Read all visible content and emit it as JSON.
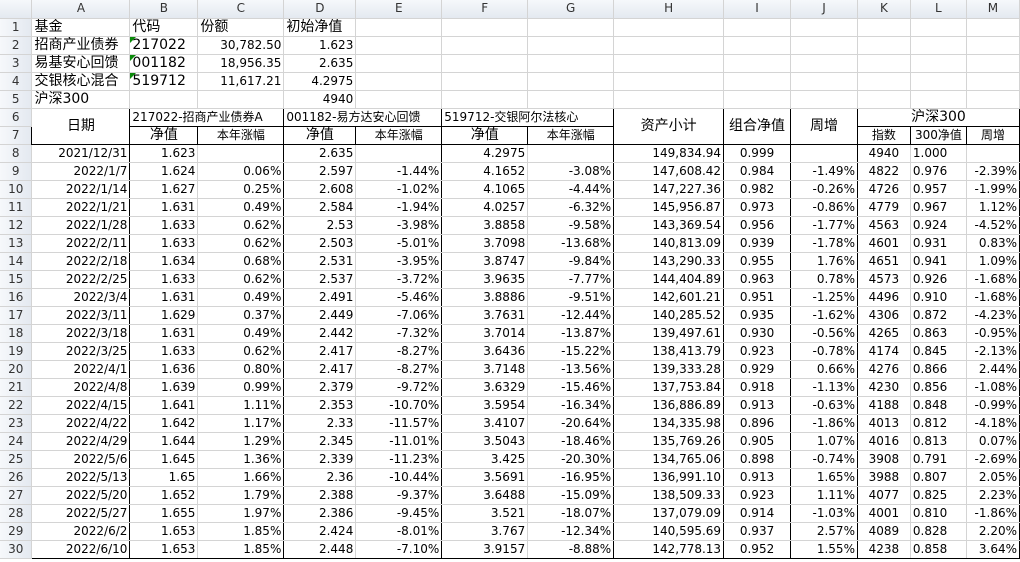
{
  "columns": [
    "A",
    "B",
    "C",
    "D",
    "E",
    "F",
    "G",
    "H",
    "I",
    "J",
    "K",
    "L",
    "M"
  ],
  "info_rows": [
    {
      "row": "1",
      "a": "基金",
      "b": "代码",
      "c": "份额",
      "d": "初始净值"
    },
    {
      "row": "2",
      "a": "招商产业债券",
      "b": "217022",
      "c": "30,782.50",
      "d": "1.623"
    },
    {
      "row": "3",
      "a": "易基安心回馈",
      "b": "001182",
      "c": "18,956.35",
      "d": "2.635"
    },
    {
      "row": "4",
      "a": "交银核心混合",
      "b": "519712",
      "c": "11,617.21",
      "d": "4.2975"
    },
    {
      "row": "5",
      "a": "沪深300",
      "b": "",
      "c": "",
      "d": "4940"
    }
  ],
  "header": {
    "row6": "6",
    "row7": "7",
    "date": "日期",
    "fund1": "217022-招商产业债券A",
    "fund2": "001182-易方达安心回馈",
    "fund3": "519712-交银阿尔法核心",
    "asset": "资产小计",
    "combo": "组合净值",
    "weekly": "周增",
    "hs300": "沪深300",
    "nav": "净值",
    "ytd": "本年涨幅",
    "index": "指数",
    "nav300": "300净值",
    "wk": "周增"
  },
  "rows": [
    {
      "row": "8",
      "date": "2021/12/31",
      "n1": "1.623",
      "y1": "",
      "n2": "2.635",
      "y2": "",
      "n3": "4.2975",
      "y3": "",
      "asset": "149,834.94",
      "combo": "0.999",
      "wk": "",
      "idx": "4940",
      "nav300": "1.000",
      "wk300": ""
    },
    {
      "row": "9",
      "date": "2022/1/7",
      "n1": "1.624",
      "y1": "0.06%",
      "n2": "2.597",
      "y2": "-1.44%",
      "n3": "4.1652",
      "y3": "-3.08%",
      "asset": "147,608.42",
      "combo": "0.984",
      "wk": "-1.49%",
      "idx": "4822",
      "nav300": "0.976",
      "wk300": "-2.39%"
    },
    {
      "row": "10",
      "date": "2022/1/14",
      "n1": "1.627",
      "y1": "0.25%",
      "n2": "2.608",
      "y2": "-1.02%",
      "n3": "4.1065",
      "y3": "-4.44%",
      "asset": "147,227.36",
      "combo": "0.982",
      "wk": "-0.26%",
      "idx": "4726",
      "nav300": "0.957",
      "wk300": "-1.99%"
    },
    {
      "row": "11",
      "date": "2022/1/21",
      "n1": "1.631",
      "y1": "0.49%",
      "n2": "2.584",
      "y2": "-1.94%",
      "n3": "4.0257",
      "y3": "-6.32%",
      "asset": "145,956.87",
      "combo": "0.973",
      "wk": "-0.86%",
      "idx": "4779",
      "nav300": "0.967",
      "wk300": "1.12%"
    },
    {
      "row": "12",
      "date": "2022/1/28",
      "n1": "1.633",
      "y1": "0.62%",
      "n2": "2.53",
      "y2": "-3.98%",
      "n3": "3.8858",
      "y3": "-9.58%",
      "asset": "143,369.54",
      "combo": "0.956",
      "wk": "-1.77%",
      "idx": "4563",
      "nav300": "0.924",
      "wk300": "-4.52%"
    },
    {
      "row": "13",
      "date": "2022/2/11",
      "n1": "1.633",
      "y1": "0.62%",
      "n2": "2.503",
      "y2": "-5.01%",
      "n3": "3.7098",
      "y3": "-13.68%",
      "asset": "140,813.09",
      "combo": "0.939",
      "wk": "-1.78%",
      "idx": "4601",
      "nav300": "0.931",
      "wk300": "0.83%"
    },
    {
      "row": "14",
      "date": "2022/2/18",
      "n1": "1.634",
      "y1": "0.68%",
      "n2": "2.531",
      "y2": "-3.95%",
      "n3": "3.8747",
      "y3": "-9.84%",
      "asset": "143,290.33",
      "combo": "0.955",
      "wk": "1.76%",
      "idx": "4651",
      "nav300": "0.941",
      "wk300": "1.09%"
    },
    {
      "row": "15",
      "date": "2022/2/25",
      "n1": "1.633",
      "y1": "0.62%",
      "n2": "2.537",
      "y2": "-3.72%",
      "n3": "3.9635",
      "y3": "-7.77%",
      "asset": "144,404.89",
      "combo": "0.963",
      "wk": "0.78%",
      "idx": "4573",
      "nav300": "0.926",
      "wk300": "-1.68%"
    },
    {
      "row": "16",
      "date": "2022/3/4",
      "n1": "1.631",
      "y1": "0.49%",
      "n2": "2.491",
      "y2": "-5.46%",
      "n3": "3.8886",
      "y3": "-9.51%",
      "asset": "142,601.21",
      "combo": "0.951",
      "wk": "-1.25%",
      "idx": "4496",
      "nav300": "0.910",
      "wk300": "-1.68%"
    },
    {
      "row": "17",
      "date": "2022/3/11",
      "n1": "1.629",
      "y1": "0.37%",
      "n2": "2.449",
      "y2": "-7.06%",
      "n3": "3.7631",
      "y3": "-12.44%",
      "asset": "140,285.52",
      "combo": "0.935",
      "wk": "-1.62%",
      "idx": "4306",
      "nav300": "0.872",
      "wk300": "-4.23%"
    },
    {
      "row": "18",
      "date": "2022/3/18",
      "n1": "1.631",
      "y1": "0.49%",
      "n2": "2.442",
      "y2": "-7.32%",
      "n3": "3.7014",
      "y3": "-13.87%",
      "asset": "139,497.61",
      "combo": "0.930",
      "wk": "-0.56%",
      "idx": "4265",
      "nav300": "0.863",
      "wk300": "-0.95%"
    },
    {
      "row": "19",
      "date": "2022/3/25",
      "n1": "1.633",
      "y1": "0.62%",
      "n2": "2.417",
      "y2": "-8.27%",
      "n3": "3.6436",
      "y3": "-15.22%",
      "asset": "138,413.79",
      "combo": "0.923",
      "wk": "-0.78%",
      "idx": "4174",
      "nav300": "0.845",
      "wk300": "-2.13%"
    },
    {
      "row": "20",
      "date": "2022/4/1",
      "n1": "1.636",
      "y1": "0.80%",
      "n2": "2.417",
      "y2": "-8.27%",
      "n3": "3.7148",
      "y3": "-13.56%",
      "asset": "139,333.28",
      "combo": "0.929",
      "wk": "0.66%",
      "idx": "4276",
      "nav300": "0.866",
      "wk300": "2.44%"
    },
    {
      "row": "21",
      "date": "2022/4/8",
      "n1": "1.639",
      "y1": "0.99%",
      "n2": "2.379",
      "y2": "-9.72%",
      "n3": "3.6329",
      "y3": "-15.46%",
      "asset": "137,753.84",
      "combo": "0.918",
      "wk": "-1.13%",
      "idx": "4230",
      "nav300": "0.856",
      "wk300": "-1.08%"
    },
    {
      "row": "22",
      "date": "2022/4/15",
      "n1": "1.641",
      "y1": "1.11%",
      "n2": "2.353",
      "y2": "-10.70%",
      "n3": "3.5954",
      "y3": "-16.34%",
      "asset": "136,886.89",
      "combo": "0.913",
      "wk": "-0.63%",
      "idx": "4188",
      "nav300": "0.848",
      "wk300": "-0.99%"
    },
    {
      "row": "23",
      "date": "2022/4/22",
      "n1": "1.642",
      "y1": "1.17%",
      "n2": "2.33",
      "y2": "-11.57%",
      "n3": "3.4107",
      "y3": "-20.64%",
      "asset": "134,335.98",
      "combo": "0.896",
      "wk": "-1.86%",
      "idx": "4013",
      "nav300": "0.812",
      "wk300": "-4.18%"
    },
    {
      "row": "24",
      "date": "2022/4/29",
      "n1": "1.644",
      "y1": "1.29%",
      "n2": "2.345",
      "y2": "-11.01%",
      "n3": "3.5043",
      "y3": "-18.46%",
      "asset": "135,769.26",
      "combo": "0.905",
      "wk": "1.07%",
      "idx": "4016",
      "nav300": "0.813",
      "wk300": "0.07%"
    },
    {
      "row": "25",
      "date": "2022/5/6",
      "n1": "1.645",
      "y1": "1.36%",
      "n2": "2.339",
      "y2": "-11.23%",
      "n3": "3.425",
      "y3": "-20.30%",
      "asset": "134,765.06",
      "combo": "0.898",
      "wk": "-0.74%",
      "idx": "3908",
      "nav300": "0.791",
      "wk300": "-2.69%"
    },
    {
      "row": "26",
      "date": "2022/5/13",
      "n1": "1.65",
      "y1": "1.66%",
      "n2": "2.36",
      "y2": "-10.44%",
      "n3": "3.5691",
      "y3": "-16.95%",
      "asset": "136,991.10",
      "combo": "0.913",
      "wk": "1.65%",
      "idx": "3988",
      "nav300": "0.807",
      "wk300": "2.05%"
    },
    {
      "row": "27",
      "date": "2022/5/20",
      "n1": "1.652",
      "y1": "1.79%",
      "n2": "2.388",
      "y2": "-9.37%",
      "n3": "3.6488",
      "y3": "-15.09%",
      "asset": "138,509.33",
      "combo": "0.923",
      "wk": "1.11%",
      "idx": "4077",
      "nav300": "0.825",
      "wk300": "2.23%"
    },
    {
      "row": "28",
      "date": "2022/5/27",
      "n1": "1.655",
      "y1": "1.97%",
      "n2": "2.386",
      "y2": "-9.45%",
      "n3": "3.521",
      "y3": "-18.07%",
      "asset": "137,079.09",
      "combo": "0.914",
      "wk": "-1.03%",
      "idx": "4001",
      "nav300": "0.810",
      "wk300": "-1.86%"
    },
    {
      "row": "29",
      "date": "2022/6/2",
      "n1": "1.653",
      "y1": "1.85%",
      "n2": "2.424",
      "y2": "-8.01%",
      "n3": "3.767",
      "y3": "-12.34%",
      "asset": "140,595.69",
      "combo": "0.937",
      "wk": "2.57%",
      "idx": "4089",
      "nav300": "0.828",
      "wk300": "2.20%"
    },
    {
      "row": "30",
      "date": "2022/6/10",
      "n1": "1.653",
      "y1": "1.85%",
      "n2": "2.448",
      "y2": "-7.10%",
      "n3": "3.9157",
      "y3": "-8.88%",
      "asset": "142,778.13",
      "combo": "0.952",
      "wk": "1.55%",
      "idx": "4238",
      "nav300": "0.858",
      "wk300": "3.64%"
    }
  ]
}
